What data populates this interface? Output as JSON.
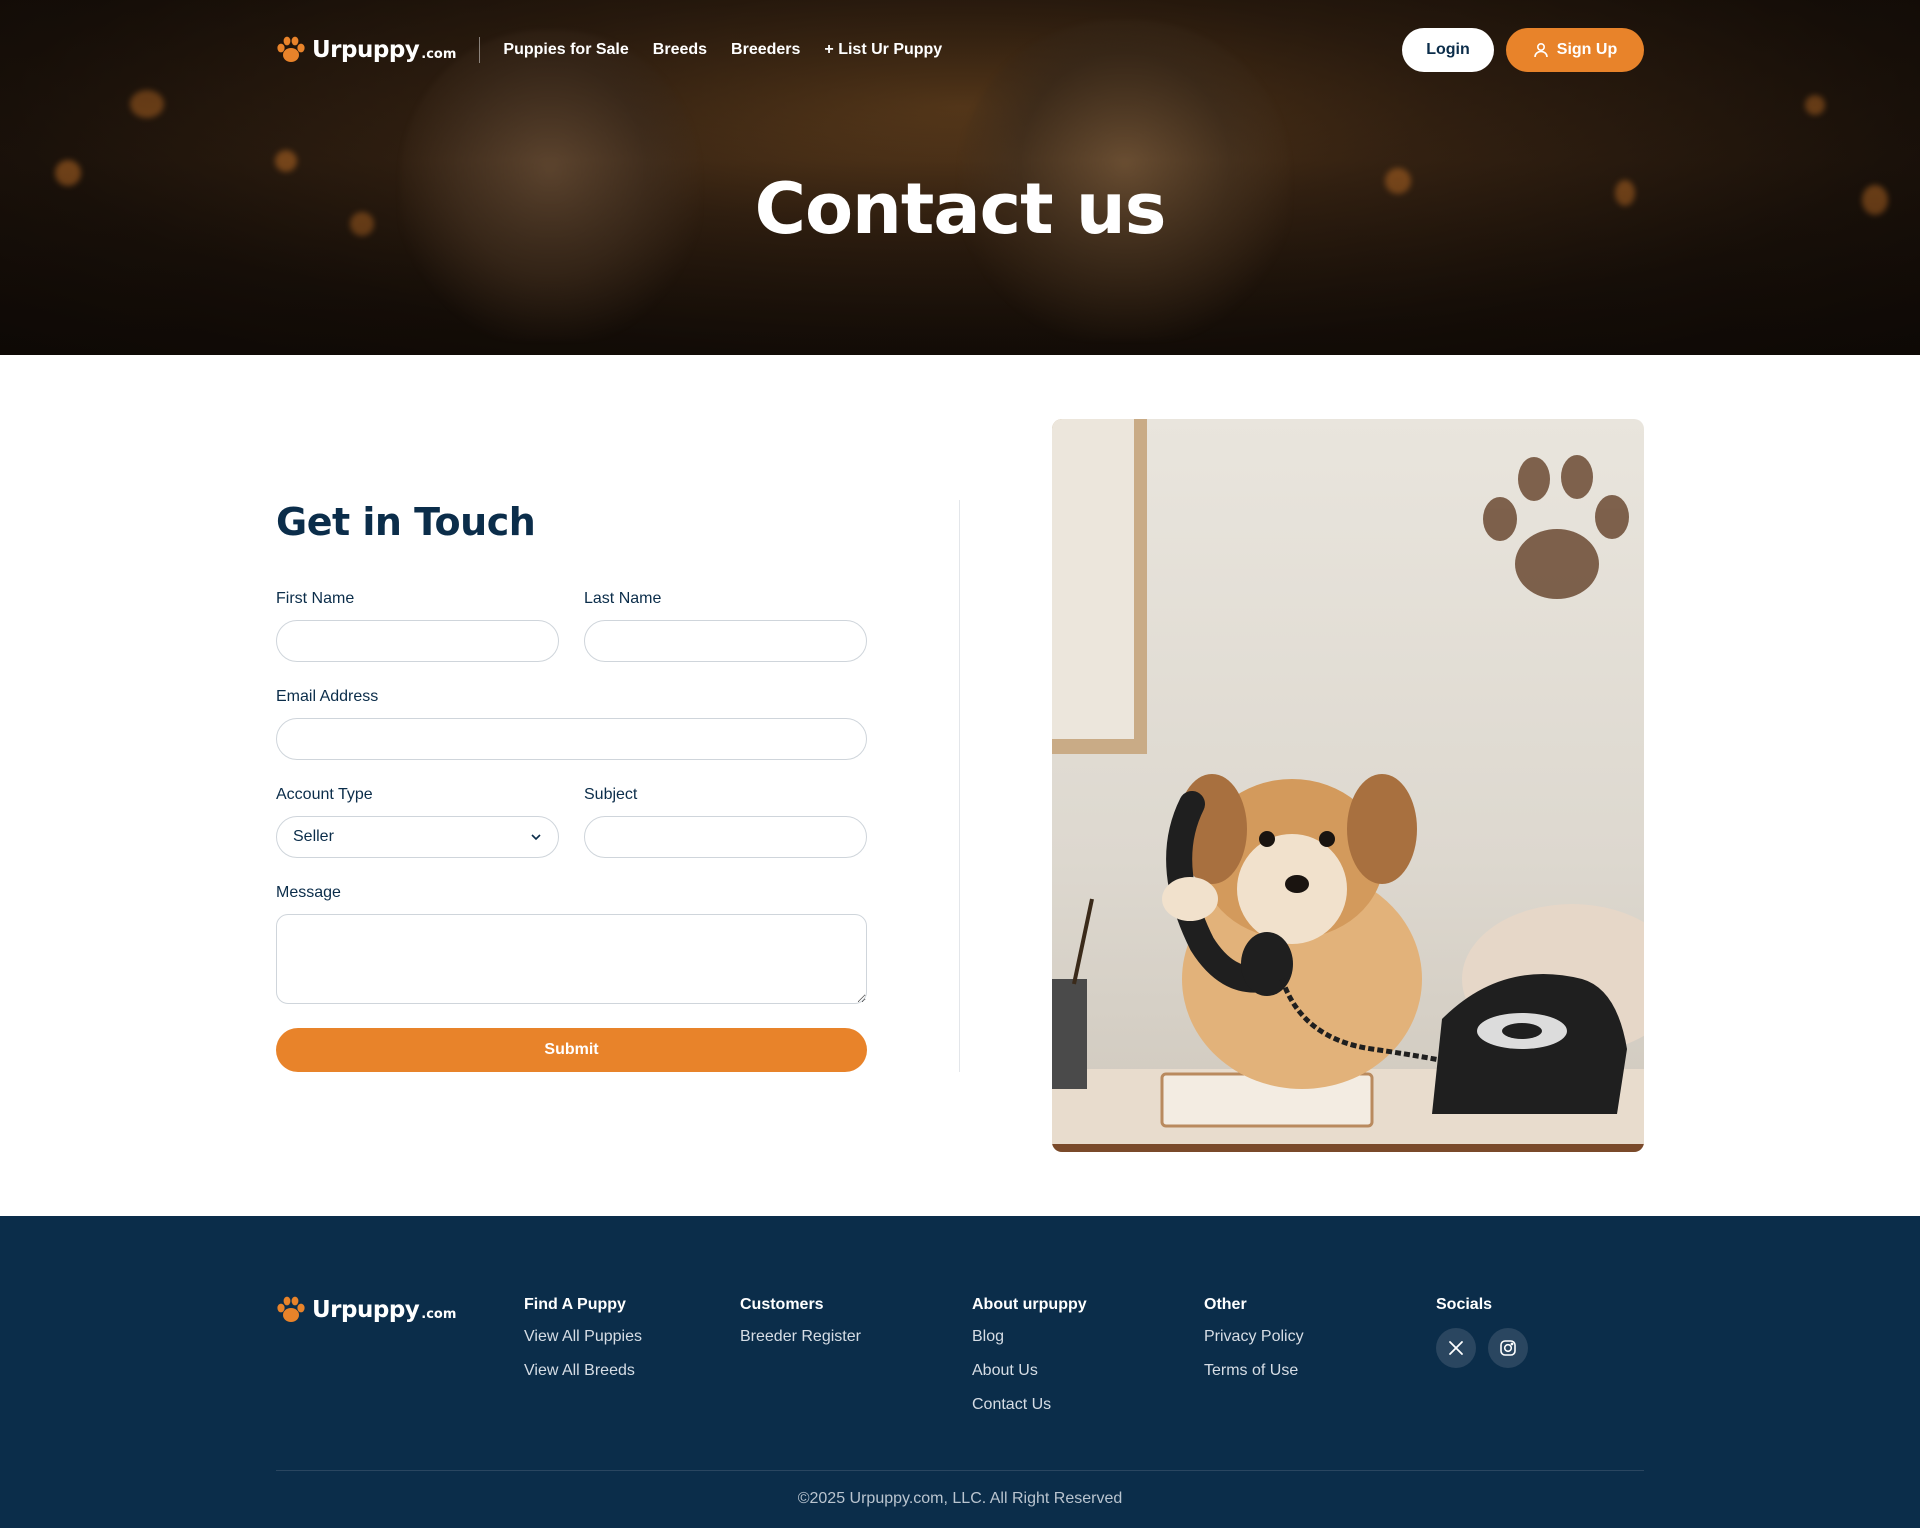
{
  "brand": {
    "name": "Urpuppy",
    "tld": ".com",
    "accent_color": "#e8832a",
    "navy_color": "#0b2d4a"
  },
  "nav": {
    "links": [
      "Puppies for Sale",
      "Breeds",
      "Breeders",
      "+ List Ur Puppy"
    ],
    "login_label": "Login",
    "signup_label": "Sign Up",
    "signup_icon": "user-icon"
  },
  "hero": {
    "title": "Contact us"
  },
  "form": {
    "heading": "Get in Touch",
    "first_name_label": "First Name",
    "first_name_value": "",
    "last_name_label": "Last Name",
    "last_name_value": "",
    "email_label": "Email Address",
    "email_value": "",
    "account_type_label": "Account Type",
    "account_type_value": "Seller",
    "subject_label": "Subject",
    "subject_value": "",
    "message_label": "Message",
    "message_value": "",
    "submit_label": "Submit"
  },
  "photo": {
    "icons": [
      "paw-print-icon",
      "telephone-icon"
    ]
  },
  "footer": {
    "columns": [
      {
        "heading": "Find A Puppy",
        "links": [
          "View All Puppies",
          "View All Breeds"
        ]
      },
      {
        "heading": "Customers",
        "links": [
          "Breeder Register"
        ]
      },
      {
        "heading": "About urpuppy",
        "links": [
          "Blog",
          "About Us",
          "Contact Us"
        ]
      },
      {
        "heading": "Other",
        "links": [
          "Privacy Policy",
          "Terms of Use"
        ]
      }
    ],
    "socials_heading": "Socials",
    "social_icons": [
      "x-icon",
      "instagram-icon"
    ],
    "copyright": "©2025 Urpuppy.com, LLC. All Right Reserved"
  }
}
